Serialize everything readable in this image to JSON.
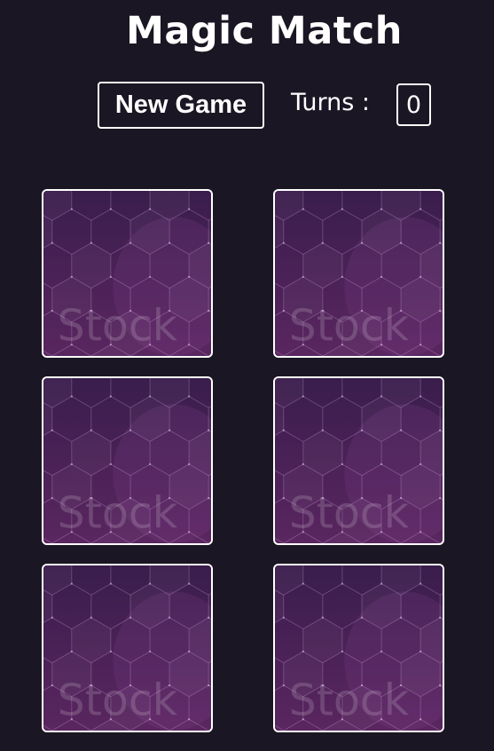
{
  "header": {
    "title": "Magic Match"
  },
  "controls": {
    "new_game_label": "New Game",
    "turns_label": "Turns :",
    "turns_value": "0"
  },
  "cards": [
    {
      "face": "hidden",
      "back_watermark": "Stock"
    },
    {
      "face": "hidden",
      "back_watermark": "Stock"
    },
    {
      "face": "hidden",
      "back_watermark": "Stock"
    },
    {
      "face": "hidden",
      "back_watermark": "Stock"
    },
    {
      "face": "hidden",
      "back_watermark": "Stock"
    },
    {
      "face": "hidden",
      "back_watermark": "Stock"
    }
  ],
  "colors": {
    "background": "#1b1623",
    "card_back_top": "#3a1d4d",
    "card_back_bottom": "#5a2660",
    "border": "#ffffff"
  }
}
